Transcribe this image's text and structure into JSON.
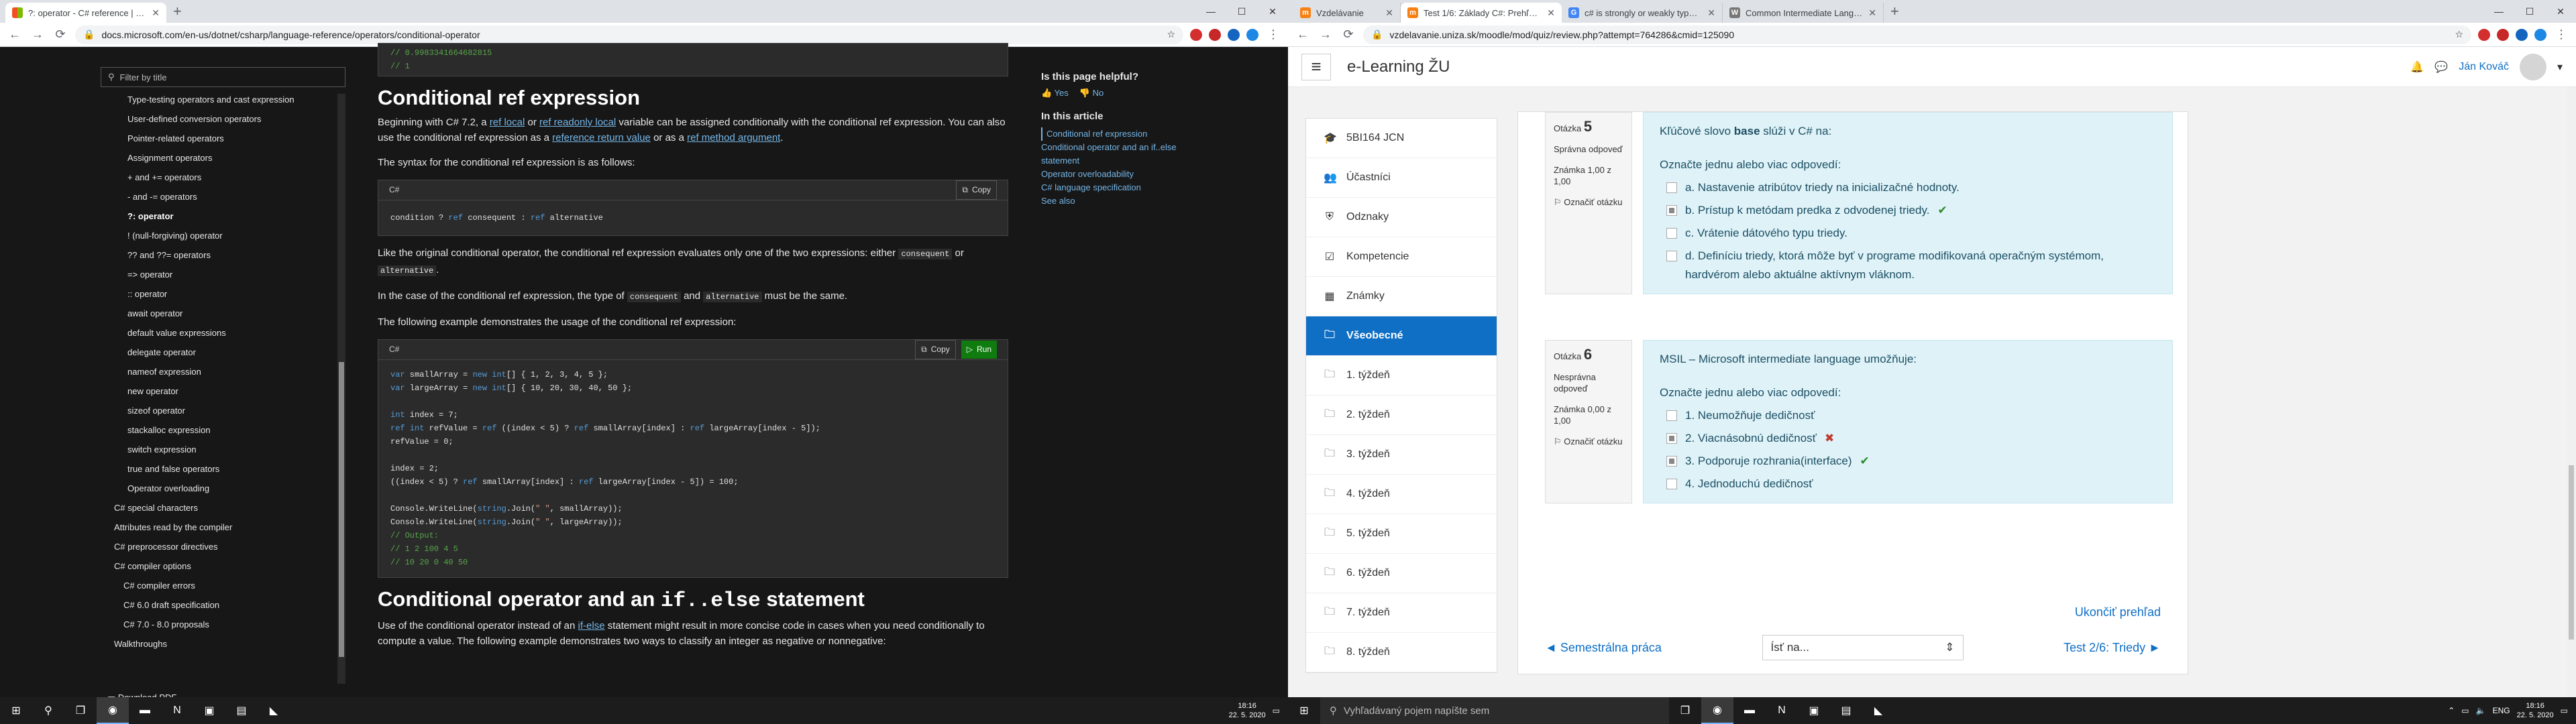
{
  "left_screen": {
    "tabs": [
      {
        "title": "?: operator - C# reference | Micr...",
        "favicon": "microsoft",
        "active": true
      }
    ],
    "new_tab": "+",
    "url": "docs.microsoft.com/en-us/dotnet/csharp/language-reference/operators/conditional-operator",
    "sidebar": {
      "filter_placeholder": "Filter by title",
      "items": [
        "Type-testing operators and cast expression",
        "User-defined conversion operators",
        "Pointer-related operators",
        "Assignment operators",
        "+ and += operators",
        "- and -= operators",
        "?: operator",
        "! (null-forgiving) operator",
        "?? and ??= operators",
        "=> operator",
        ":: operator",
        "await operator",
        "default value expressions",
        "delegate operator",
        "nameof expression",
        "new operator",
        "sizeof operator",
        "stackalloc expression",
        "switch expression",
        "true and false operators",
        "Operator overloading",
        "C# special characters",
        "Attributes read by the compiler",
        "C# preprocessor directives",
        "C# compiler options",
        "C# compiler errors",
        "C# 6.0 draft specification",
        "C# 7.0 - 8.0 proposals",
        "Walkthroughs"
      ],
      "selected_index": 6,
      "download_pdf": "Download PDF"
    },
    "top_code_lines": [
      "// 0.9983341664682815",
      "// 1"
    ],
    "section1_title": "Conditional ref expression",
    "p1_a": "Beginning with C# 7.2, a ",
    "p1_link1": "ref local",
    "p1_b": " or ",
    "p1_link2": "ref readonly local",
    "p1_c": " variable can be assigned conditionally with the conditional ref expression. You can also use the conditional ref expression as a ",
    "p1_link3": "reference return value",
    "p1_d": " or as a ",
    "p1_link4": "ref method argument",
    "p1_e": ".",
    "p2": "The syntax for the conditional ref expression is as follows:",
    "code1_lang": "C#",
    "copy_label": "Copy",
    "run_label": "Run",
    "code1_line": "condition ? ref consequent : ref alternative",
    "p3_a": "Like the original conditional operator, the conditional ref expression evaluates only one of the two expressions: either ",
    "p3_code1": "consequent",
    "p3_b": " or ",
    "p3_code2": "alternative",
    "p3_c": ".",
    "p4_a": "In the case of the conditional ref expression, the type of ",
    "p4_code1": "consequent",
    "p4_b": " and ",
    "p4_code2": "alternative",
    "p4_c": " must be the same.",
    "p5": "The following example demonstrates the usage of the conditional ref expression:",
    "code2_lang": "C#",
    "code2": "var smallArray = new int[] { 1, 2, 3, 4, 5 };\nvar largeArray = new int[] { 10, 20, 30, 40, 50 };\n\nint index = 7;\nref int refValue = ref ((index < 5) ? ref smallArray[index] : ref largeArray[index - 5]);\nrefValue = 0;\n\nindex = 2;\n((index < 5) ? ref smallArray[index] : ref largeArray[index - 5]) = 100;\n\nConsole.WriteLine(string.Join(\" \", smallArray));\nConsole.WriteLine(string.Join(\" \", largeArray));\n// Output:\n// 1 2 100 4 5\n// 10 20 0 40 50",
    "section2_title_a": "Conditional operator and an ",
    "section2_title_code": "if..else",
    "section2_title_b": " statement",
    "p6_a": "Use of the conditional operator instead of an ",
    "p6_link": "if-else",
    "p6_b": " statement might result in more concise code in cases when you need conditionally to compute a value. The following example demonstrates two ways to classify an integer as negative or nonnegative:",
    "right_rail": {
      "helpful": "Is this page helpful?",
      "yes": "Yes",
      "no": "No",
      "in_article": "In this article",
      "links": [
        "Conditional ref expression",
        "Conditional operator and an if..else statement",
        "Operator overloadability",
        "C# language specification",
        "See also"
      ]
    },
    "clock_time": "18:16",
    "clock_date": "22. 5. 2020"
  },
  "right_screen": {
    "tabs": [
      {
        "title": "Vzdelávanie",
        "favicon": "moodle",
        "active": false
      },
      {
        "title": "Test 1/6: Základy C#: Prehľad po...",
        "favicon": "moodle",
        "active": true
      },
      {
        "title": "c# is strongly or weakly typed la...",
        "favicon": "google",
        "active": false
      },
      {
        "title": "Common Intermediate Language -...",
        "favicon": "wikipedia",
        "active": false
      }
    ],
    "new_tab": "+",
    "url": "vzdelavanie.uniza.sk/moodle/mod/quiz/review.php?attempt=764286&cmid=125090",
    "brand": "e-Learning ŽU",
    "user_name": "Ján Kováč",
    "nav": [
      {
        "label": "5BI164 JCN",
        "icon": "graduation-cap"
      },
      {
        "label": "Účastníci",
        "icon": "users"
      },
      {
        "label": "Odznaky",
        "icon": "shield"
      },
      {
        "label": "Kompetencie",
        "icon": "check-square"
      },
      {
        "label": "Známky",
        "icon": "table"
      },
      {
        "label": "Všeobecné",
        "icon": "folder",
        "active": true
      },
      {
        "label": "1. týždeň",
        "icon": "folder"
      },
      {
        "label": "2. týždeň",
        "icon": "folder"
      },
      {
        "label": "3. týždeň",
        "icon": "folder"
      },
      {
        "label": "4. týždeň",
        "icon": "folder"
      },
      {
        "label": "5. týždeň",
        "icon": "folder"
      },
      {
        "label": "6. týždeň",
        "icon": "folder"
      },
      {
        "label": "7. týždeň",
        "icon": "folder"
      },
      {
        "label": "8. týždeň",
        "icon": "folder"
      }
    ],
    "questions": [
      {
        "label": "Otázka",
        "number": "5",
        "status": "Správna odpoveď",
        "grade": "Známka 1,00 z 1,00",
        "flag": "Označiť otázku",
        "text_a": "Kľúčové slovo ",
        "text_bold": "base",
        "text_b": " slúži v C# na:",
        "prompt": "Označte jednu alebo viac odpovedí:",
        "options": [
          {
            "text": "a. Nastavenie atribútov triedy na inicializačné hodnoty.",
            "checked": false,
            "mark": ""
          },
          {
            "text": "b. Prístup k metódam predka z odvodenej triedy.",
            "checked": true,
            "mark": "correct"
          },
          {
            "text": "c. Vrátenie dátového typu triedy.",
            "checked": false,
            "mark": ""
          },
          {
            "text": "d. Definíciu triedy, ktorá môže byť v programe modifikovaná operačným systémom, hardvérom alebo aktuálne aktívnym vláknom.",
            "checked": false,
            "mark": ""
          }
        ]
      },
      {
        "label": "Otázka",
        "number": "6",
        "status": "Nesprávna odpoveď",
        "grade": "Známka 0,00 z 1,00",
        "flag": "Označiť otázku",
        "text_a": "MSIL – Microsoft intermediate language umožňuje:",
        "text_bold": "",
        "text_b": "",
        "prompt": "Označte jednu alebo viac odpovedí:",
        "options": [
          {
            "text": "1. Neumožňuje dedičnosť",
            "checked": false,
            "mark": ""
          },
          {
            "text": "2. Viacnásobnú dedičnosť",
            "checked": true,
            "mark": "wrong"
          },
          {
            "text": "3. Podporuje rozhrania(interface)",
            "checked": true,
            "mark": "correct"
          },
          {
            "text": "4. Jednoduchú dedičnosť",
            "checked": false,
            "mark": ""
          }
        ]
      }
    ],
    "finish_review": "Ukončiť prehľad",
    "prev_link": "◄ Semestrálna práca",
    "jump_select": "Ísť na...",
    "next_link": "Test 2/6: Triedy ►",
    "taskbar_search": "Vyhľadávaný pojem napíšte sem",
    "lang": "ENG",
    "clock_time": "18:16",
    "clock_date": "22. 5. 2020"
  }
}
